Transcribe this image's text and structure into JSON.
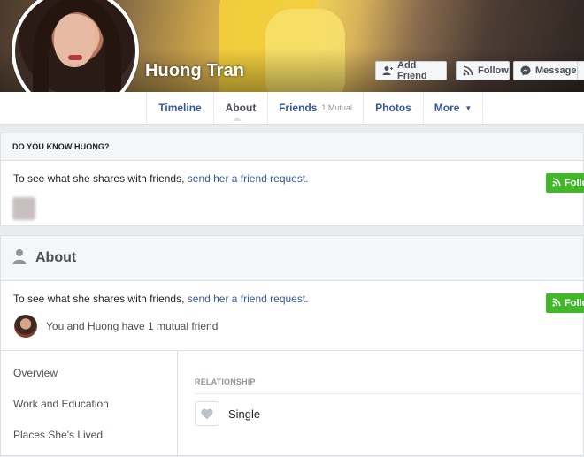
{
  "profile": {
    "name": "Huong Tran"
  },
  "cover_actions": {
    "add_friend": "Add Friend",
    "follow": "Follow",
    "message": "Message"
  },
  "nav": {
    "tabs": [
      {
        "label": "Timeline"
      },
      {
        "label": "About",
        "active": true
      },
      {
        "label": "Friends",
        "sub": "1 Mutual"
      },
      {
        "label": "Photos"
      },
      {
        "label": "More"
      }
    ]
  },
  "know_panel": {
    "heading": "DO YOU KNOW HUONG?",
    "share_prefix": "To see what she shares with friends, ",
    "share_link": "send her a friend request.",
    "button": "Follow"
  },
  "about_panel": {
    "heading": "About",
    "share_prefix": "To see what she shares with friends, ",
    "share_link": "send her a friend request.",
    "button": "Follow",
    "mutual_text": "You and Huong have 1 mutual friend",
    "side_nav": [
      "Overview",
      "Work and Education",
      "Places She's Lived"
    ],
    "relationship_heading": "RELATIONSHIP",
    "relationship_status": "Single"
  },
  "colors": {
    "link": "#365899",
    "green": "#42b72a",
    "background": "#e9ebee"
  }
}
